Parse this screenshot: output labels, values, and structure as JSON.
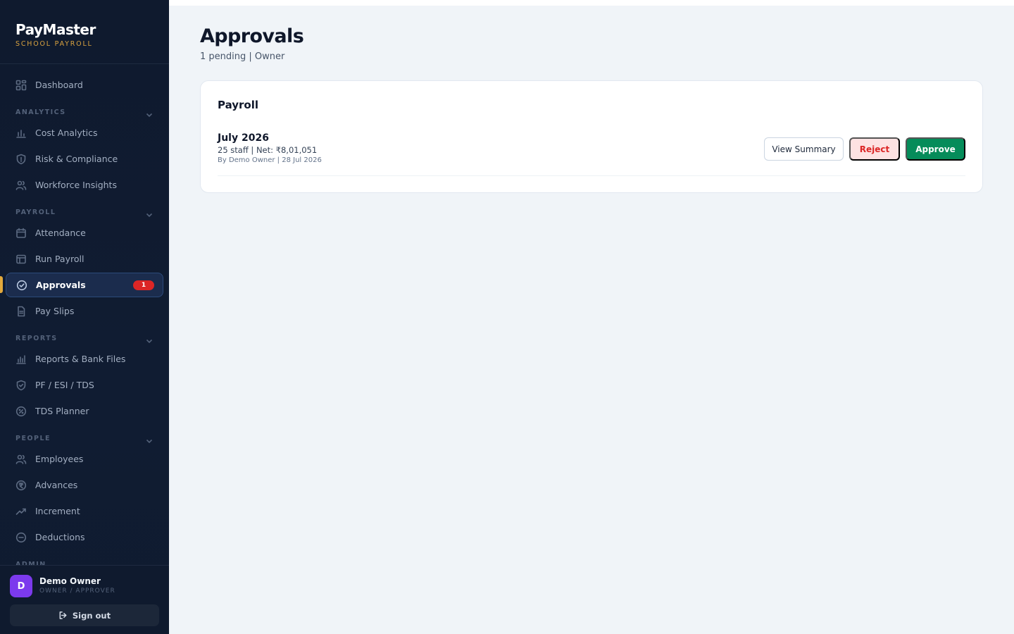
{
  "brand": {
    "title": "PayMaster",
    "subtitle": "SCHOOL PAYROLL"
  },
  "nav": {
    "dashboard": "Dashboard",
    "sections": {
      "analytics": "ANALYTICS",
      "payroll": "PAYROLL",
      "reports": "REPORTS",
      "people": "PEOPLE",
      "admin": "ADMIN"
    },
    "items": {
      "cost_analytics": "Cost Analytics",
      "risk_compliance": "Risk & Compliance",
      "workforce_insights": "Workforce Insights",
      "attendance": "Attendance",
      "run_payroll": "Run Payroll",
      "approvals": "Approvals",
      "approvals_badge": "1",
      "pay_slips": "Pay Slips",
      "reports_bank": "Reports & Bank Files",
      "pf_esi_tds": "PF / ESI / TDS",
      "tds_planner": "TDS Planner",
      "employees": "Employees",
      "advances": "Advances",
      "increment": "Increment",
      "deductions": "Deductions"
    }
  },
  "user": {
    "initial": "D",
    "name": "Demo Owner",
    "role": "OWNER / APPROVER",
    "sign_out": "Sign out"
  },
  "page": {
    "title": "Approvals",
    "subtitle": "1 pending | Owner"
  },
  "card": {
    "title": "Payroll",
    "rows": [
      {
        "title": "July 2026",
        "meta": "25 staff | Net: ₹8,01,051",
        "by": "By Demo Owner | 28 Jul 2026",
        "view_summary": "View Summary",
        "reject": "Reject",
        "approve": "Approve"
      }
    ]
  },
  "colors": {
    "sidebar_bg": "#0f1a2e",
    "accent_gold": "#d9a23f",
    "approve_green": "#058c5a",
    "reject_red": "#dc2626",
    "badge_red": "#dc2626",
    "avatar_purple": "#7c3aed"
  }
}
